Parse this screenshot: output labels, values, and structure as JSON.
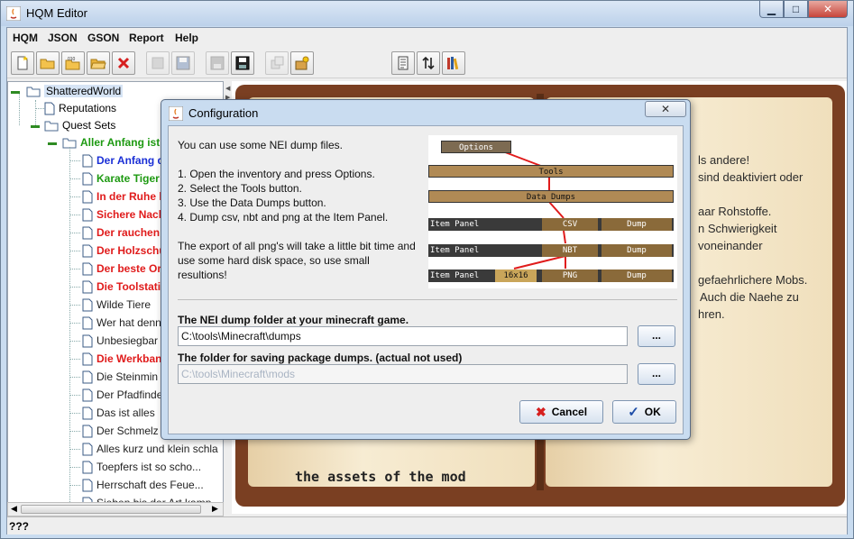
{
  "window": {
    "title": "HQM Editor"
  },
  "menu": [
    "HQM",
    "JSON",
    "GSON",
    "Report",
    "Help"
  ],
  "tree": {
    "root": "ShatteredWorld",
    "reputations": "Reputations",
    "quest_sets": "Quest Sets",
    "set": "Aller Anfang ist s",
    "quests": [
      {
        "label": "Der Anfang d",
        "color": "#1a2fd6"
      },
      {
        "label": "Karate Tiger",
        "color": "#1e9a12"
      },
      {
        "label": "In der Ruhe l",
        "color": "#e01b1b"
      },
      {
        "label": "Sichere Nach",
        "color": "#e01b1b"
      },
      {
        "label": "Der rauchen",
        "color": "#e01b1b"
      },
      {
        "label": "Der Holzschu",
        "color": "#e01b1b"
      },
      {
        "label": "Der beste Or",
        "color": "#e01b1b"
      },
      {
        "label": "Die Toolstati",
        "color": "#e01b1b"
      },
      {
        "label": "Wilde Tiere",
        "color": "#222222"
      },
      {
        "label": "Wer hat denn",
        "color": "#222222"
      },
      {
        "label": "Unbesiegbar",
        "color": "#222222"
      },
      {
        "label": "Die Werkban",
        "color": "#e01b1b"
      },
      {
        "label": "Die Steinmin",
        "color": "#222222"
      },
      {
        "label": "Der Pfadfinde",
        "color": "#222222"
      },
      {
        "label": "Das ist alles",
        "color": "#222222"
      },
      {
        "label": "Der Schmelz",
        "color": "#222222"
      },
      {
        "label": "Alles kurz und klein schla",
        "color": "#222222"
      },
      {
        "label": "Toepfers ist so scho...",
        "color": "#222222"
      },
      {
        "label": "Herrschaft des Feue...",
        "color": "#222222"
      },
      {
        "label": "Sieben bis der Art kamp",
        "color": "#222222"
      }
    ]
  },
  "book": {
    "lines": [
      "ls andere!",
      "sind deaktiviert oder",
      "",
      "aar Rohstoffe.",
      "n Schwierigkeit",
      "voneinander",
      "",
      "gefaehrlichere Mobs.",
      "Auch die Naehe zu",
      "hren."
    ],
    "mono": "the assets of the mod"
  },
  "status": "???",
  "dialog": {
    "title": "Configuration",
    "close": "✕",
    "intro": "You can use some NEI dump files.",
    "steps": [
      "1. Open the inventory and press Options.",
      "2. Select the Tools button.",
      "3. Use the Data Dumps button.",
      "4. Dump csv, nbt and png at the Item Panel."
    ],
    "note": [
      "The export of all png's will take a little bit time and",
      "use some hard disk space, so use small",
      "resultions!"
    ],
    "nei_label": "The NEI dump folder at your minecraft game.",
    "nei_value": "C:\\tools\\Minecraft\\dumps",
    "pkg_label": "The folder for saving package dumps. (actual not used)",
    "pkg_value": "C:\\tools\\Minecraft\\mods",
    "browse": "...",
    "cancel": "Cancel",
    "ok": "OK",
    "mc": {
      "options": "Options",
      "tools": "Tools",
      "data_dumps": "Data Dumps",
      "item_panel": "Item Panel",
      "csv": "CSV",
      "nbt": "NBT",
      "png": "PNG",
      "dump": "Dump",
      "size": "16x16"
    }
  }
}
